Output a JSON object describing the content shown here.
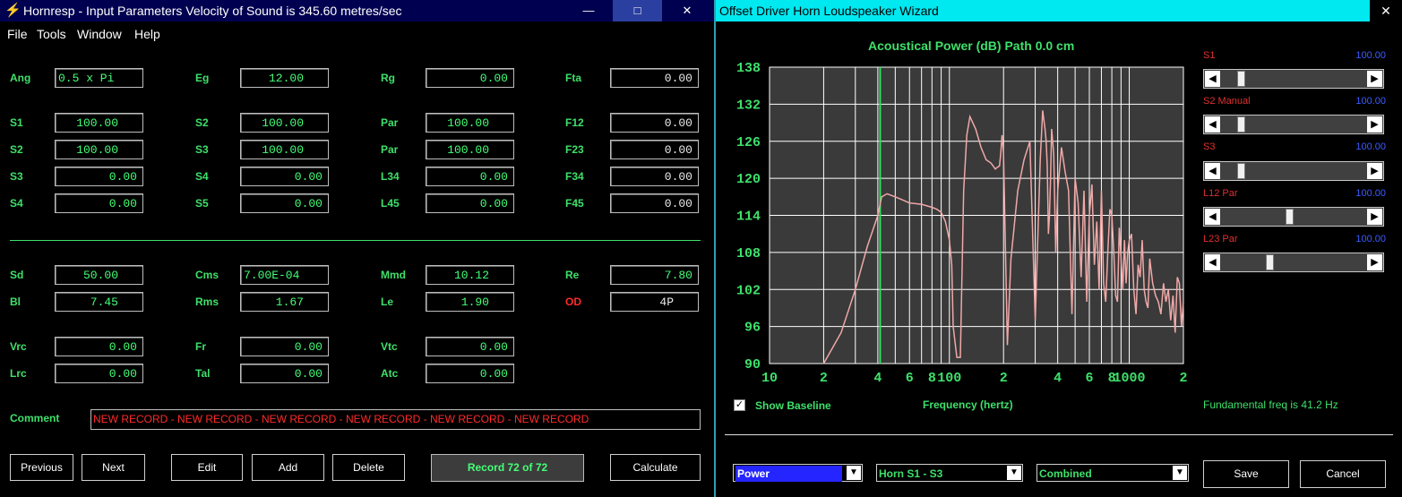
{
  "left_window": {
    "title": "Hornresp - Input Parameters   Velocity of Sound is 345.60 metres/sec",
    "min_label": "—",
    "max_label": "□",
    "close_label": "✕",
    "menu": [
      "File",
      "Tools",
      "Window",
      "Help"
    ],
    "fields": {
      "ang": {
        "label": "Ang",
        "value": "0.5 x Pi"
      },
      "eg": {
        "label": "Eg",
        "value": "12.00"
      },
      "rg": {
        "label": "Rg",
        "value": "0.00"
      },
      "fta": {
        "label": "Fta",
        "value": "0.00"
      },
      "s1": {
        "label": "S1",
        "value": "100.00"
      },
      "s2a": {
        "label": "S2",
        "value": "100.00"
      },
      "par1": {
        "label": "Par",
        "value": "100.00"
      },
      "f12": {
        "label": "F12",
        "value": "0.00"
      },
      "s2": {
        "label": "S2",
        "value": "100.00"
      },
      "s3a": {
        "label": "S3",
        "value": "100.00"
      },
      "par2": {
        "label": "Par",
        "value": "100.00"
      },
      "f23": {
        "label": "F23",
        "value": "0.00"
      },
      "s3": {
        "label": "S3",
        "value": "0.00"
      },
      "s4a": {
        "label": "S4",
        "value": "0.00"
      },
      "l34": {
        "label": "L34",
        "value": "0.00"
      },
      "f34": {
        "label": "F34",
        "value": "0.00"
      },
      "s4": {
        "label": "S4",
        "value": "0.00"
      },
      "s5": {
        "label": "S5",
        "value": "0.00"
      },
      "l45": {
        "label": "L45",
        "value": "0.00"
      },
      "f45": {
        "label": "F45",
        "value": "0.00"
      },
      "sd": {
        "label": "Sd",
        "value": "50.00"
      },
      "cms": {
        "label": "Cms",
        "value": "7.00E-04"
      },
      "mmd": {
        "label": "Mmd",
        "value": "10.12"
      },
      "re": {
        "label": "Re",
        "value": "7.80"
      },
      "bl": {
        "label": "Bl",
        "value": "7.45"
      },
      "rms": {
        "label": "Rms",
        "value": "1.67"
      },
      "le": {
        "label": "Le",
        "value": "1.90"
      },
      "od": {
        "label": "OD",
        "value": "4P"
      },
      "vrc": {
        "label": "Vrc",
        "value": "0.00"
      },
      "fr": {
        "label": "Fr",
        "value": "0.00"
      },
      "vtc": {
        "label": "Vtc",
        "value": "0.00"
      },
      "lrc": {
        "label": "Lrc",
        "value": "0.00"
      },
      "tal": {
        "label": "Tal",
        "value": "0.00"
      },
      "atc": {
        "label": "Atc",
        "value": "0.00"
      }
    },
    "comment_label": "Comment",
    "comment_value": "NEW RECORD - NEW RECORD - NEW RECORD - NEW RECORD - NEW RECORD - NEW RECORD",
    "buttons": {
      "previous": "Previous",
      "next": "Next",
      "edit": "Edit",
      "add": "Add",
      "delete": "Delete",
      "calculate": "Calculate"
    },
    "record_status": "Record 72 of 72"
  },
  "right_window": {
    "title": "Offset Driver Horn Loudspeaker Wizard",
    "close_label": "✕",
    "chart_title": "Acoustical Power (dB)   Path 0.0 cm",
    "show_baseline_label": "Show Baseline",
    "show_baseline_checked": true,
    "fundamental_text": "Fundamental freq is 41.2 Hz",
    "sliders": [
      {
        "label": "S1",
        "value": "100.00",
        "position": 0.12
      },
      {
        "label": "S2 Manual",
        "value": "100.00",
        "position": 0.12
      },
      {
        "label": "S3",
        "value": "100.00",
        "position": 0.12
      },
      {
        "label": "L12 Par",
        "value": "100.00",
        "position": 0.47
      },
      {
        "label": "L23 Par",
        "value": "100.00",
        "position": 0.33
      }
    ],
    "dropdowns": {
      "mode": "Power",
      "path": "Horn S1 - S3",
      "combo": "Combined"
    },
    "buttons": {
      "save": "Save",
      "cancel": "Cancel"
    },
    "colors": {
      "accent": "#3ee06a",
      "curve": "#f0a8a8",
      "marker": "#2ee05a",
      "grid": "#ffffff"
    }
  },
  "chart_data": {
    "type": "line",
    "title": "Acoustical Power (dB)   Path 0.0 cm",
    "xlabel": "Frequency (hertz)",
    "ylabel": "",
    "x_scale": "log",
    "xlim": [
      10,
      2000
    ],
    "ylim": [
      90,
      138
    ],
    "yticks": [
      90,
      96,
      102,
      108,
      114,
      120,
      126,
      132,
      138
    ],
    "xtick_labels": [
      {
        "f": 10,
        "t": "10"
      },
      {
        "f": 20,
        "t": "2"
      },
      {
        "f": 40,
        "t": "4"
      },
      {
        "f": 60,
        "t": "6"
      },
      {
        "f": 80,
        "t": "8"
      },
      {
        "f": 100,
        "t": "100"
      },
      {
        "f": 200,
        "t": "2"
      },
      {
        "f": 400,
        "t": "4"
      },
      {
        "f": 600,
        "t": "6"
      },
      {
        "f": 800,
        "t": "8"
      },
      {
        "f": 1000,
        "t": "1000"
      },
      {
        "f": 2000,
        "t": "2"
      }
    ],
    "grid": true,
    "marker_frequency": 41.2,
    "series": [
      {
        "x": [
          20,
          25,
          30,
          35,
          40,
          42,
          45,
          50,
          55,
          60,
          70,
          80,
          85,
          90,
          95,
          100,
          103,
          105,
          110,
          115,
          120,
          125,
          130,
          140,
          150,
          160,
          170,
          175,
          180,
          185,
          190,
          193,
          196,
          200,
          210,
          220,
          240,
          260,
          280,
          300,
          320,
          330,
          340,
          345,
          350,
          355,
          360,
          365,
          370,
          380,
          390,
          400,
          420,
          440,
          460,
          480,
          500,
          520,
          540,
          560,
          580,
          600,
          620,
          640,
          660,
          680,
          700,
          720,
          740,
          760,
          780,
          800,
          820,
          840,
          860,
          880,
          900,
          920,
          940,
          960,
          980,
          1000,
          1030,
          1060,
          1090,
          1120,
          1150,
          1180,
          1210,
          1240,
          1270,
          1300,
          1350,
          1400,
          1450,
          1500,
          1550,
          1600,
          1650,
          1700,
          1750,
          1800,
          1850,
          1900,
          1950,
          2000
        ],
        "y": [
          90,
          95,
          102,
          109,
          114,
          117,
          117.5,
          117,
          116.5,
          116,
          115.8,
          115.3,
          115,
          114.5,
          113,
          110,
          106,
          96,
          91,
          91,
          118,
          127,
          130,
          128,
          125,
          123,
          122.5,
          122,
          121.5,
          121.8,
          122,
          124,
          127,
          124,
          93,
          107,
          118,
          123,
          126,
          97,
          123,
          131,
          128,
          126,
          122,
          111,
          114,
          120,
          128,
          124,
          108,
          118,
          125,
          121,
          118,
          98,
          120,
          116,
          104,
          118,
          100,
          114,
          119,
          106,
          113,
          102,
          118,
          103,
          100,
          108,
          115,
          114,
          108,
          101,
          100,
          112,
          107,
          102,
          110,
          103,
          108,
          110,
          111,
          102,
          98,
          106,
          104,
          110,
          102,
          100,
          99,
          107,
          103,
          101,
          100,
          98,
          103,
          100,
          102,
          97,
          101,
          95,
          104,
          103,
          96,
          100
        ]
      }
    ]
  }
}
